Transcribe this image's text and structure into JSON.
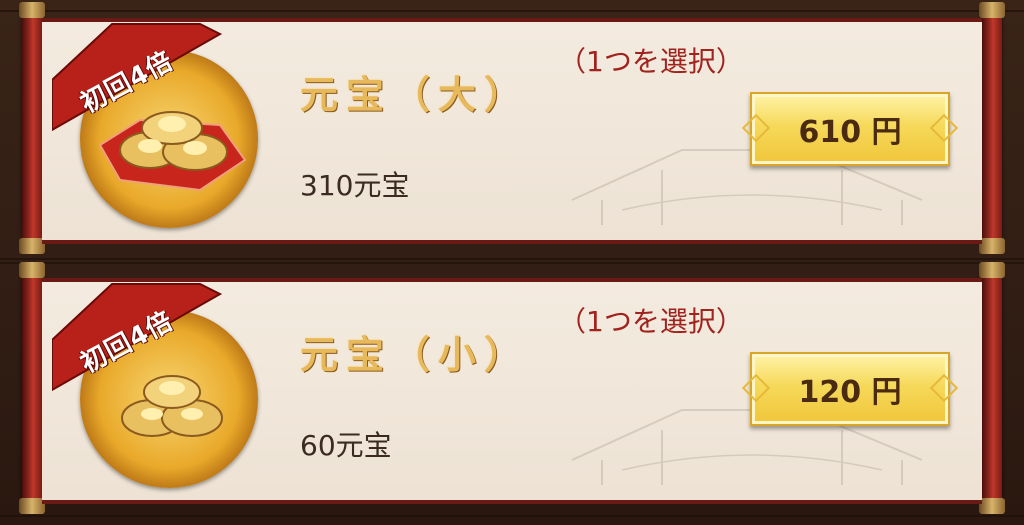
{
  "shop": {
    "items": [
      {
        "badge": "初回4倍",
        "title": "元宝（大）",
        "amount": "310元宝",
        "select_note": "（1つを選択）",
        "price": "610 円",
        "icon": "gold-ingots-large-icon"
      },
      {
        "badge": "初回4倍",
        "title": "元宝（小）",
        "amount": "60元宝",
        "select_note": "（1つを選択）",
        "price": "120 円",
        "icon": "gold-ingots-small-icon"
      }
    ]
  },
  "colors": {
    "title_gold": "#e8b95a",
    "note_red": "#a0231e",
    "button_gold": "#f6d95a",
    "ribbon_red": "#b8201a"
  }
}
